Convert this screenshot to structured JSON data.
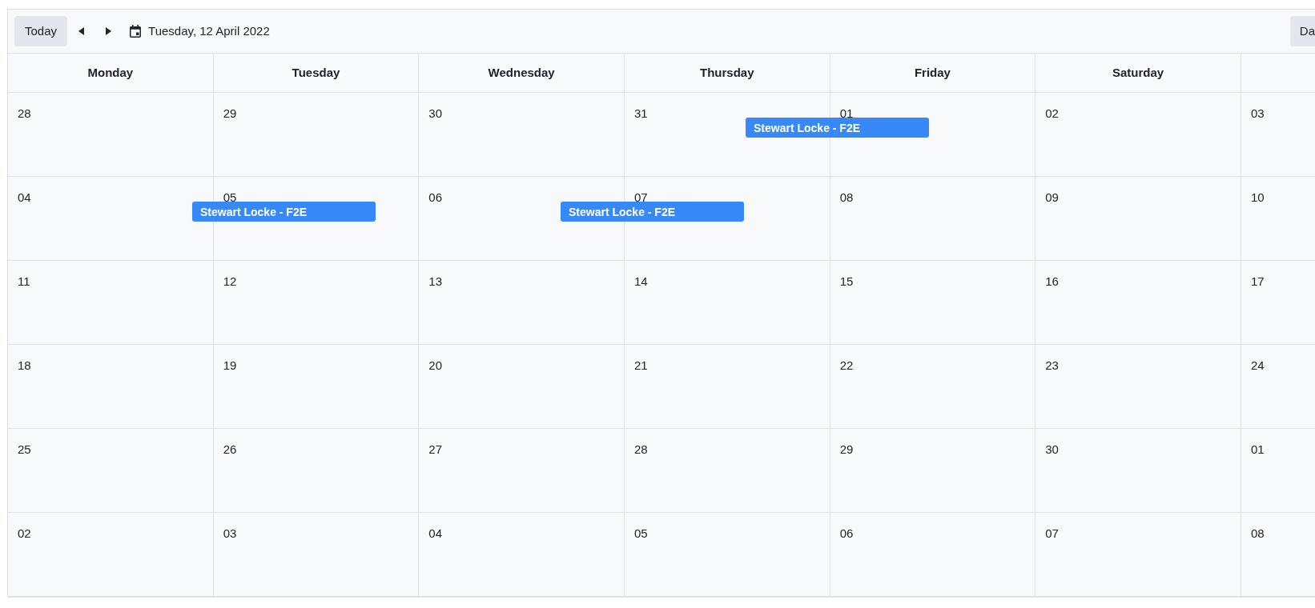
{
  "toolbar": {
    "today_button": "Today",
    "date_label": "Tuesday, 12 April 2022",
    "view_button": "Da"
  },
  "columns": [
    "Monday",
    "Tuesday",
    "Wednesday",
    "Thursday",
    "Friday",
    "Saturday"
  ],
  "weeks": [
    {
      "days": [
        "28",
        "29",
        "30",
        "31",
        "01",
        "02",
        "03"
      ],
      "events": [
        {
          "title": "Stewart Locke - F2E"
        }
      ]
    },
    {
      "days": [
        "04",
        "05",
        "06",
        "07",
        "08",
        "09",
        "10"
      ],
      "events": [
        {
          "title": "Stewart Locke - F2E"
        },
        {
          "title": "Stewart Locke - F2E"
        }
      ]
    },
    {
      "days": [
        "11",
        "12",
        "13",
        "14",
        "15",
        "16",
        "17"
      ]
    },
    {
      "days": [
        "18",
        "19",
        "20",
        "21",
        "22",
        "23",
        "24"
      ]
    },
    {
      "days": [
        "25",
        "26",
        "27",
        "28",
        "29",
        "30",
        "01"
      ]
    },
    {
      "days": [
        "02",
        "03",
        "04",
        "05",
        "06",
        "07",
        "08"
      ]
    }
  ]
}
